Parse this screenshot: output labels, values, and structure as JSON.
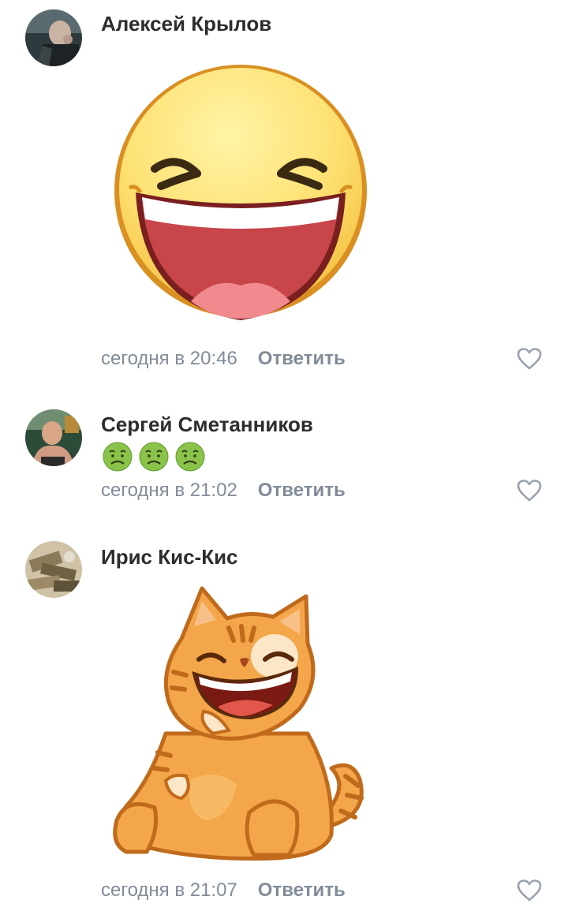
{
  "comments": [
    {
      "author": "Алексей Крылов",
      "time": "сегодня в 20:46",
      "reply_label": "Ответить",
      "sticker": "laughing-smiley-sticker",
      "avatar": "man-in-dark-shirt-avatar"
    },
    {
      "author": "Сергей Сметанников",
      "time": "сегодня в 21:02",
      "reply_label": "Ответить",
      "emojis": [
        "nauseated-face-emoji",
        "nauseated-face-emoji",
        "nauseated-face-emoji"
      ],
      "avatar": "shirtless-man-avatar"
    },
    {
      "author": "Ирис Кис-Кис",
      "time": "сегодня в 21:07",
      "reply_label": "Ответить",
      "sticker": "laughing-orange-cat-sticker",
      "avatar": "money-pile-avatar"
    }
  ],
  "colors": {
    "author": "#2c2d2e",
    "meta": "#818c99",
    "heart_outline": "#99a2ad"
  }
}
